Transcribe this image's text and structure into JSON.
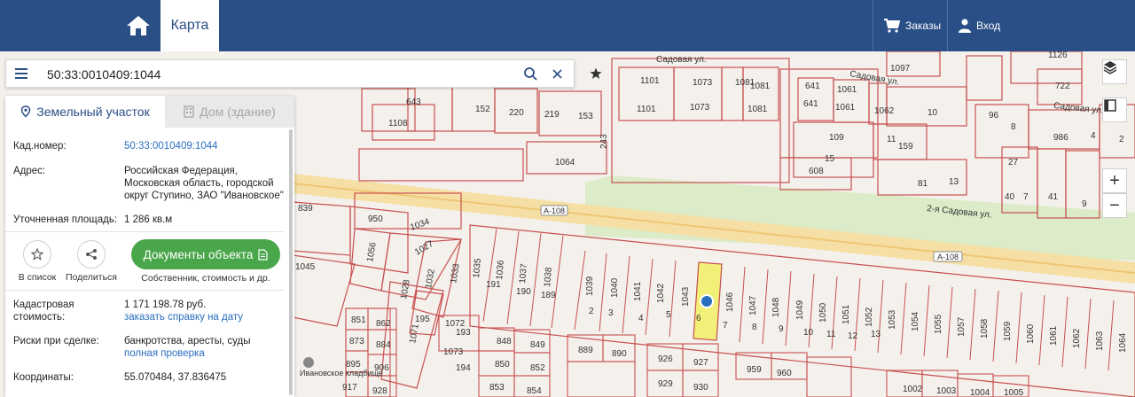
{
  "header": {
    "map_tab": "Карта",
    "orders": "Заказы",
    "login": "Вход"
  },
  "search": {
    "value": "50:33:0010409:1044"
  },
  "panel": {
    "tab_land": "Земельный участок",
    "tab_house": "Дом (здание)",
    "cad_label": "Кад.номер:",
    "cad_value": "50:33:0010409:1044",
    "addr_label": "Адрес:",
    "addr_value": "Российская Федерация, Московская область, городской округ Ступино, ЗАО \"Ивановское\"",
    "area_label": "Уточненная площадь:",
    "area_value": "1 286 кв.м",
    "add_list": "В список",
    "share": "Поделиться",
    "docs_button": "Документы объекта",
    "docs_sub": "Собственник, стоимость и др.",
    "cost_label": "Кадастровая стоимость:",
    "cost_value": "1 171 198.78 руб.",
    "cost_link": "заказать справку на дату",
    "risk_label": "Риски при сделке:",
    "risk_value": "банкротства, аресты, суды",
    "risk_link": "полная проверка",
    "coord_label": "Координаты:",
    "coord_value": "55.070484, 37.836475"
  },
  "map": {
    "roads": [
      "А-108",
      "А-108",
      "2-я Садовая ул.",
      "Садовая ул.",
      "Садовая ул.",
      "Садовая ул."
    ],
    "cemetery": "Ивановское кладбище",
    "top_parcels": [
      "1101",
      "1101",
      "1073",
      "1073",
      "1081",
      "1081",
      "1081",
      "1097",
      "1126",
      "722",
      "641",
      "641",
      "1061",
      "1061",
      "1062",
      "10",
      "96",
      "8",
      "986",
      "4",
      "2",
      "109",
      "11",
      "159",
      "608",
      "15",
      "81",
      "13",
      "27",
      "40",
      "7",
      "41",
      "9",
      "1064",
      "643",
      "152",
      "220",
      "219",
      "153",
      "1108",
      "243"
    ],
    "left_parcels": [
      "839",
      "950",
      "1034",
      "1056",
      "1045",
      "1027",
      "1028",
      "1032",
      "1033",
      "1035",
      "1036",
      "1037",
      "1038",
      "191",
      "190",
      "189"
    ],
    "bottom_row1": [
      "1039",
      "1040",
      "1041",
      "1042",
      "1043",
      "1046",
      "1047",
      "1048",
      "1049",
      "1050",
      "1051",
      "1052",
      "1053",
      "1054",
      "1055",
      "1057",
      "1058",
      "1059",
      "1060",
      "1061",
      "1062",
      "1063",
      "1064"
    ],
    "bottom_row1_nums": [
      "2",
      "3",
      "4",
      "5",
      "6",
      "7",
      "8",
      "9",
      "10",
      "11",
      "12",
      "13"
    ],
    "bottom_parcels": [
      "851",
      "862",
      "195",
      "1072",
      "193",
      "848",
      "849",
      "889",
      "890",
      "926",
      "927",
      "959",
      "960",
      "873",
      "884",
      "1071",
      "1073",
      "850",
      "852",
      "929",
      "930",
      "895",
      "906",
      "194",
      "917",
      "928",
      "854",
      "853",
      "1002",
      "1003",
      "1004",
      "1005"
    ]
  }
}
